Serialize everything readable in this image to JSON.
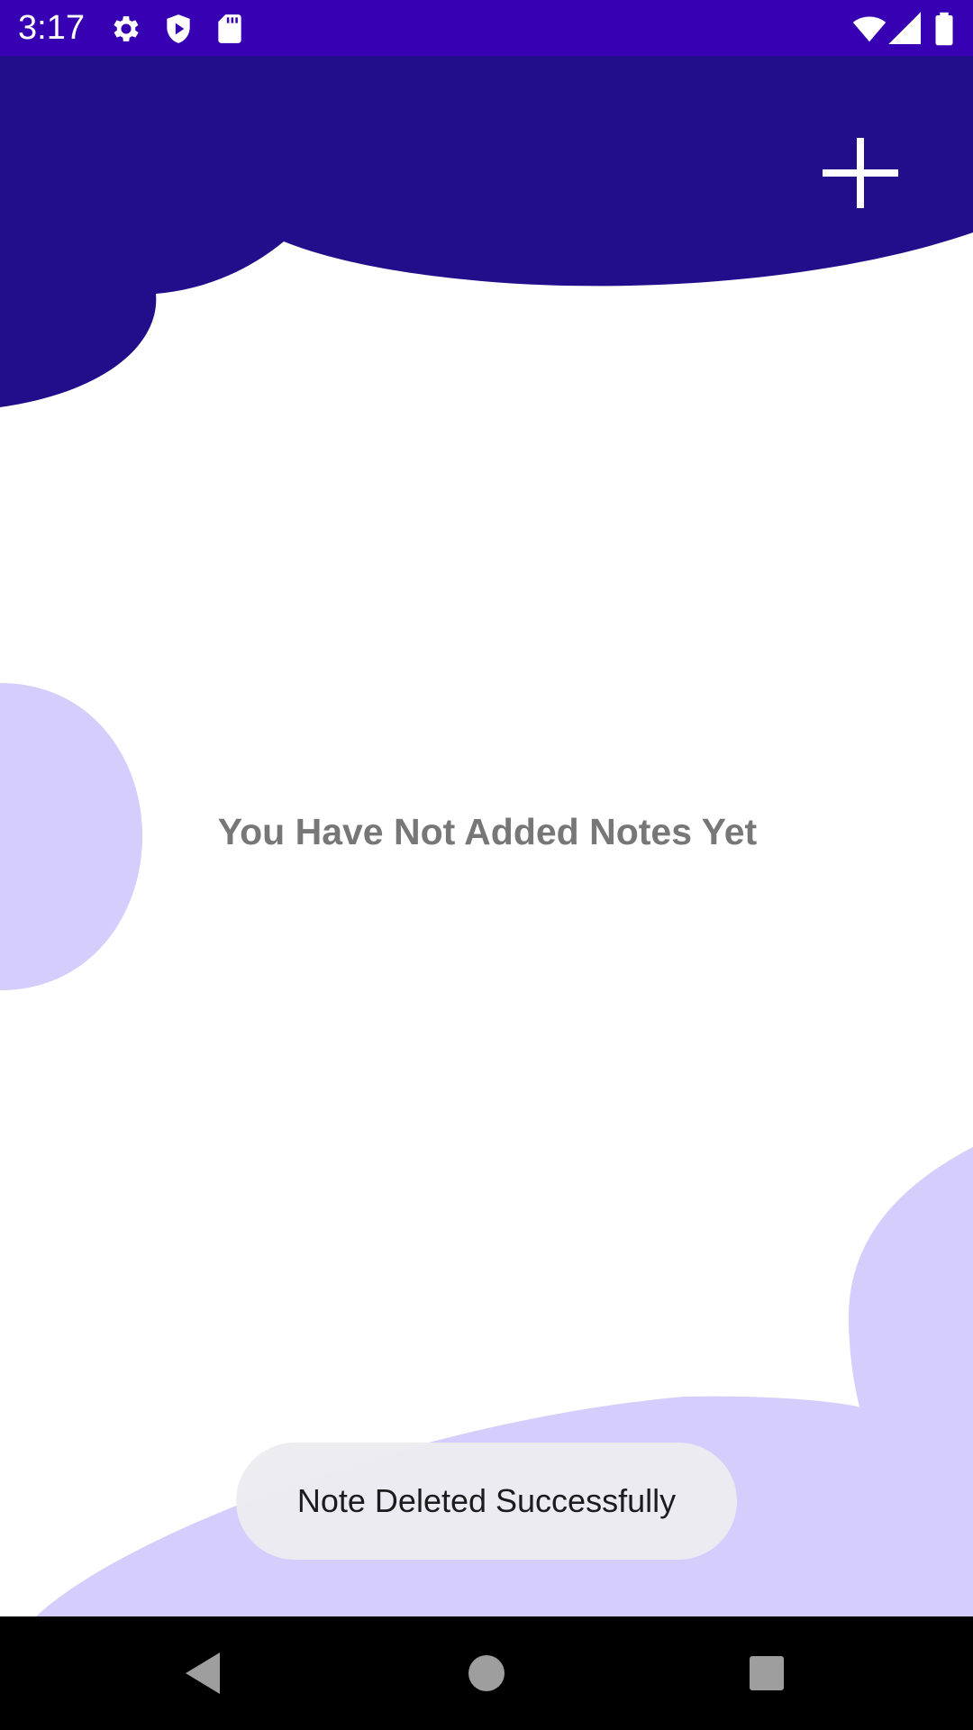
{
  "status_bar": {
    "time": "3:17",
    "background_color": "#3700b3",
    "left_icons": [
      "settings-gear-icon",
      "shield-play-icon",
      "sd-card-icon"
    ],
    "right_icons": [
      "wifi-icon",
      "cellular-signal-icon",
      "battery-icon"
    ]
  },
  "header": {
    "add_button_icon": "plus-icon",
    "wave_color": "#220e8a"
  },
  "main": {
    "empty_message": "You Have Not Added Notes Yet",
    "accent_light_color": "#d5cdfb"
  },
  "toast": {
    "message": "Note Deleted Successfully"
  },
  "nav_bar": {
    "buttons": [
      "back-icon",
      "home-icon",
      "recents-icon"
    ]
  }
}
